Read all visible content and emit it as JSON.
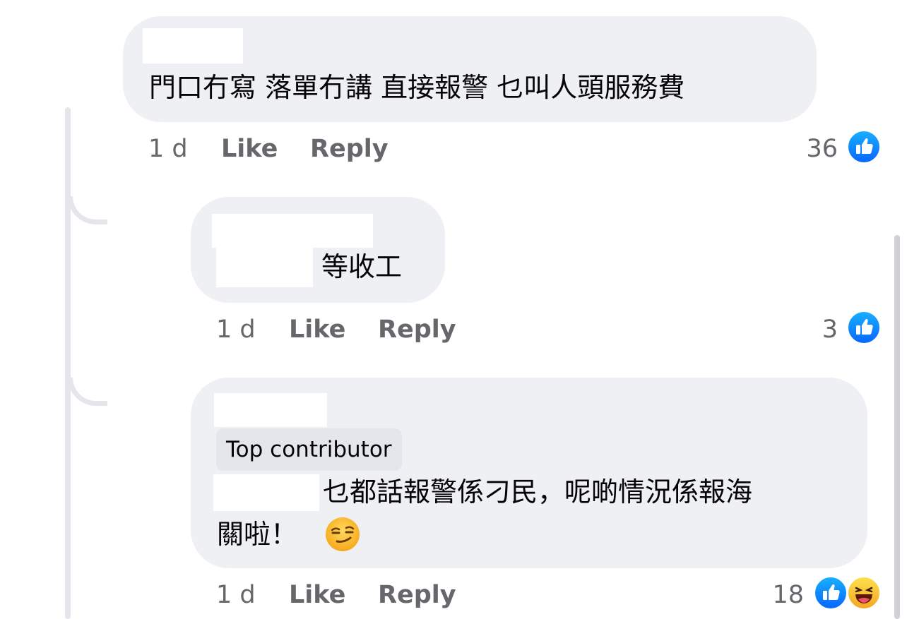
{
  "comments": [
    {
      "text": "門口冇寫 落單冇講 直接報警 乜叫人頭服務費",
      "time": "1 d",
      "like_label": "Like",
      "reply_label": "Reply",
      "reaction_count": "36",
      "reactions": [
        "like-icon"
      ]
    },
    {
      "text": "等收工",
      "time": "1 d",
      "like_label": "Like",
      "reply_label": "Reply",
      "reaction_count": "3",
      "reactions": [
        "like-icon"
      ]
    },
    {
      "badge": "Top contributor",
      "text_line1": "乜都話報警係刁民，呢啲情況係報海",
      "text_line2": "關啦！",
      "emoji": "smirking-face-emoji",
      "time": "1 d",
      "like_label": "Like",
      "reply_label": "Reply",
      "reaction_count": "18",
      "reactions": [
        "like-icon",
        "haha-icon"
      ]
    }
  ],
  "colors": {
    "bubble_bg": "#eff0f3",
    "muted_text": "#65676b",
    "like_blue": "#0866ff",
    "thread_line": "#e4e6eb"
  }
}
